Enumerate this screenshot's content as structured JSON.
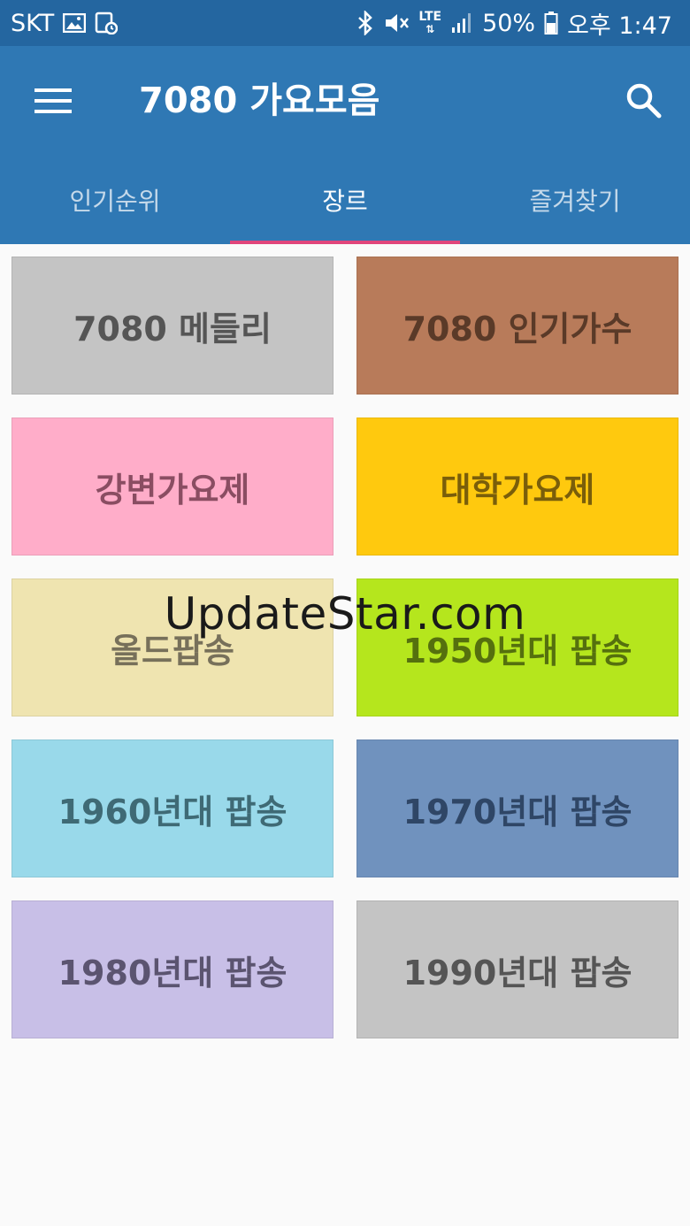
{
  "status_bar": {
    "carrier": "SKT",
    "battery": "50%",
    "time": "오후 1:47",
    "network": "LTE",
    "icons": [
      "image-icon",
      "screenshot-icon",
      "bluetooth-icon",
      "mute-icon",
      "lte-icon",
      "signal-icon",
      "battery-icon"
    ]
  },
  "app_bar": {
    "title": "7080 가요모음",
    "color": "#2f78b4",
    "status_color": "#2466a0"
  },
  "tabs": [
    {
      "label": "인기순위",
      "active": false
    },
    {
      "label": "장르",
      "active": true
    },
    {
      "label": "즐겨찾기",
      "active": false
    }
  ],
  "tab_indicator_color": "#e0457b",
  "genres": [
    {
      "label": "7080 메들리",
      "bg": "#c4c4c4",
      "fg": "#555555"
    },
    {
      "label": "7080 인기가수",
      "bg": "#b87b5a",
      "fg": "#5a3a28"
    },
    {
      "label": "강변가요제",
      "bg": "#ffadc9",
      "fg": "#8a4d62"
    },
    {
      "label": "대학가요제",
      "bg": "#ffc90e",
      "fg": "#7a5e0a"
    },
    {
      "label": "올드팝송",
      "bg": "#efe4b0",
      "fg": "#77705a"
    },
    {
      "label": "1950년대 팝송",
      "bg": "#b5e61d",
      "fg": "#55700e"
    },
    {
      "label": "1960년대 팝송",
      "bg": "#99d9ea",
      "fg": "#3f6a75"
    },
    {
      "label": "1970년대 팝송",
      "bg": "#7092be",
      "fg": "#2f4666"
    },
    {
      "label": "1980년대 팝송",
      "bg": "#c8bfe7",
      "fg": "#5b5470"
    },
    {
      "label": "1990년대 팝송",
      "bg": "#c4c4c4",
      "fg": "#555555"
    }
  ],
  "watermark": "UpdateStar.com"
}
